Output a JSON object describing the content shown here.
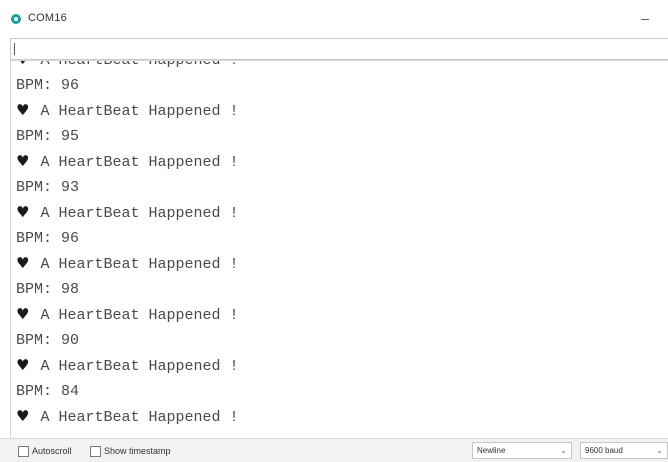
{
  "window": {
    "title": "COM16",
    "minimize_glyph": "–",
    "app_icon": "arduino-serial-icon",
    "accent_color": "#17a1a5"
  },
  "send_input": {
    "value": "",
    "placeholder": ""
  },
  "output": {
    "lines": [
      {
        "heart": "♥",
        "text": "A HeartBeat Happened !"
      },
      {
        "heart": "",
        "text": "BPM: 96"
      },
      {
        "heart": "♥",
        "text": "A HeartBeat Happened !"
      },
      {
        "heart": "",
        "text": "BPM: 95"
      },
      {
        "heart": "♥",
        "text": "A HeartBeat Happened !"
      },
      {
        "heart": "",
        "text": "BPM: 93"
      },
      {
        "heart": "♥",
        "text": "A HeartBeat Happened !"
      },
      {
        "heart": "",
        "text": "BPM: 96"
      },
      {
        "heart": "♥",
        "text": "A HeartBeat Happened !"
      },
      {
        "heart": "",
        "text": "BPM: 98"
      },
      {
        "heart": "♥",
        "text": "A HeartBeat Happened !"
      },
      {
        "heart": "",
        "text": "BPM: 90"
      },
      {
        "heart": "♥",
        "text": "A HeartBeat Happened !"
      },
      {
        "heart": "",
        "text": "BPM: 84"
      },
      {
        "heart": "♥",
        "text": "A HeartBeat Happened !"
      }
    ]
  },
  "statusbar": {
    "autoscroll_label": "Autoscroll",
    "autoscroll_checked": false,
    "timestamp_label": "Show timestamp",
    "timestamp_checked": false,
    "line_ending": "Newline",
    "baud_rate": "9600 baud"
  }
}
